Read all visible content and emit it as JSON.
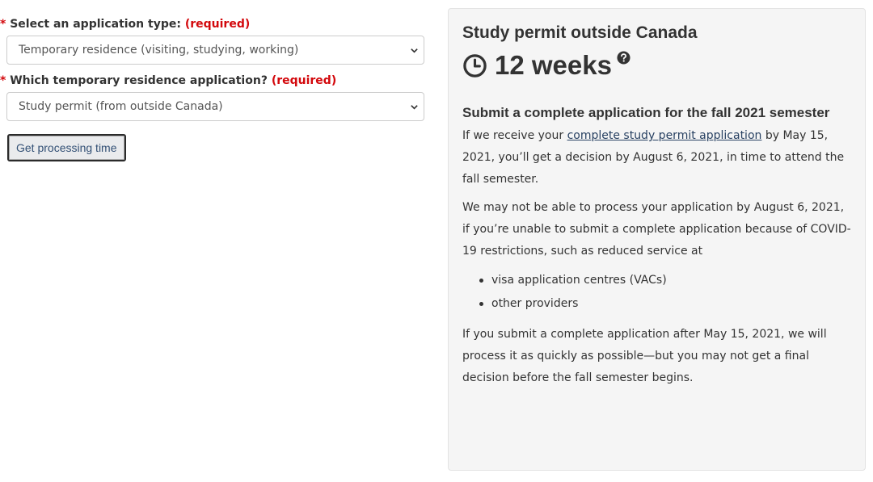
{
  "form": {
    "application_type": {
      "label": "Select an application type:",
      "required_marker": "*",
      "required_text": "(required)",
      "selected": "Temporary residence (visiting, studying, working)"
    },
    "temporary_residence": {
      "label": "Which temporary residence application?",
      "required_marker": "*",
      "required_text": "(required)",
      "selected": "Study permit (from outside Canada)"
    },
    "submit_label": "Get processing time"
  },
  "result": {
    "title": "Study permit outside Canada",
    "processing_time": "12 weeks",
    "notice": {
      "heading": "Submit a complete application for the fall 2021 semester",
      "p1_before": "If we receive your ",
      "p1_link": "complete study permit application",
      "p1_after": " by May 15, 2021, you’ll get a decision by August 6, 2021, in time to attend the fall semester.",
      "p2": "We may not be able to process your application by August 6, 2021, if you’re unable to submit a complete application because of COVID-19 restrictions, such as reduced service at",
      "bullets": [
        "visa application centres (VACs)",
        "other providers"
      ],
      "p3": "If you submit a complete application after May 15, 2021, we will process it as quickly as possible—but you may not get a final decision before the fall semester begins."
    }
  },
  "icons": {
    "clock": "clock-icon",
    "help": "question-circle-icon",
    "dropdown": "chevron-down-icon"
  },
  "colors": {
    "required": "#d3080c",
    "link": "#284162",
    "panel_bg": "#f5f5f5"
  }
}
